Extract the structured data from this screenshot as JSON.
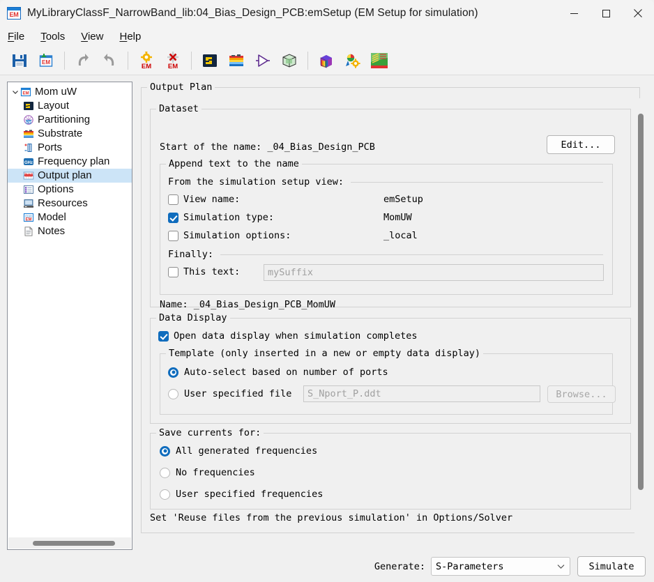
{
  "window": {
    "title": "MyLibraryClassF_NarrowBand_lib:04_Bias_Design_PCB:emSetup (EM Setup for simulation)",
    "app_icon": "em-window-icon",
    "app_icon_text": "EM",
    "minimize": "minimize-icon",
    "maximize": "maximize-icon",
    "close": "close-icon"
  },
  "menubar": {
    "items": [
      {
        "label": "File",
        "accel": "F"
      },
      {
        "label": "Tools",
        "accel": "T"
      },
      {
        "label": "View",
        "accel": "V"
      },
      {
        "label": "Help",
        "accel": "H"
      }
    ]
  },
  "toolbar": {
    "buttons": [
      {
        "name": "save-icon",
        "title": "Save"
      },
      {
        "name": "save-em-icon",
        "title": "Save EM setup"
      },
      {
        "name": "undo-icon",
        "title": "Undo"
      },
      {
        "name": "redo-icon",
        "title": "Redo"
      },
      {
        "name": "em-settings-icon",
        "title": "EM settings"
      },
      {
        "name": "em-delete-icon",
        "title": "Delete EM"
      },
      {
        "name": "layout-icon",
        "title": "Layout"
      },
      {
        "name": "substrate-icon",
        "title": "Substrate"
      },
      {
        "name": "simulate-icon",
        "title": "Simulate"
      },
      {
        "name": "3d-view-icon",
        "title": "3D view"
      },
      {
        "name": "3d-cube-icon",
        "title": "3D EM view"
      },
      {
        "name": "em-model-icon",
        "title": "EM model"
      },
      {
        "name": "em-mesh-icon",
        "title": "Mesh view"
      }
    ]
  },
  "sidebar": {
    "root": {
      "label": "Mom uW",
      "icon": "em-icon",
      "expanded": true,
      "twist": "chevron-down-icon"
    },
    "items": [
      {
        "label": "Layout",
        "icon": "layout-icon",
        "selected": false
      },
      {
        "label": "Partitioning",
        "icon": "partitioning-icon",
        "selected": false
      },
      {
        "label": "Substrate",
        "icon": "substrate-icon",
        "selected": false
      },
      {
        "label": "Ports",
        "icon": "ports-icon",
        "selected": false
      },
      {
        "label": "Frequency plan",
        "icon": "ghz-icon",
        "selected": false
      },
      {
        "label": "Output plan",
        "icon": "output-plan-icon",
        "selected": true
      },
      {
        "label": "Options",
        "icon": "options-icon",
        "selected": false
      },
      {
        "label": "Resources",
        "icon": "resources-icon",
        "selected": false
      },
      {
        "label": "Model",
        "icon": "model-icon",
        "selected": false
      },
      {
        "label": "Notes",
        "icon": "notes-icon",
        "selected": false
      }
    ]
  },
  "main": {
    "group_title": "Output Plan",
    "dataset": {
      "legend": "Dataset",
      "start_of_name_label": "Start of the name: _04_Bias_Design_PCB",
      "edit_button": "Edit...",
      "append": {
        "legend": "Append text to the name",
        "from_view_label": "From the simulation setup view:",
        "rows": [
          {
            "label": "View name:",
            "value": "emSetup",
            "checked": false
          },
          {
            "label": "Simulation type:",
            "value": "MomUW",
            "checked": true
          },
          {
            "label": "Simulation options:",
            "value": "_local",
            "checked": false
          }
        ],
        "finally_label": "Finally:",
        "this_text_label": "This text:",
        "this_text_checked": false,
        "this_text_placeholder": "mySuffix",
        "this_text_value": ""
      },
      "name_label": "Name: _04_Bias_Design_PCB_MomUW"
    },
    "data_display": {
      "legend": "Data Display",
      "open_label": "Open data display when simulation completes",
      "open_checked": true,
      "template": {
        "legend": "Template (only inserted in a new or empty data display)",
        "options": [
          {
            "label": "Auto-select based on number of ports",
            "selected": true
          },
          {
            "label": "User specified file",
            "selected": false
          }
        ],
        "file_value": "S_Nport_P.ddt",
        "browse_button": "Browse..."
      }
    },
    "save_currents": {
      "legend": "Save currents for:",
      "options": [
        {
          "label": "All generated frequencies",
          "selected": true
        },
        {
          "label": "No frequencies",
          "selected": false
        },
        {
          "label": "User specified frequencies",
          "selected": false
        }
      ]
    },
    "hint": "Set 'Reuse files from the previous simulation' in Options/Solver"
  },
  "bottom": {
    "generate_label": "Generate:",
    "generate_value": "S-Parameters",
    "generate_caret": "chevron-down-icon",
    "simulate_button": "Simulate"
  },
  "colors": {
    "accent": "#0f6cbd",
    "selection": "#cce4f7",
    "window_bg": "#f0f0f0",
    "panel_bg": "#ffffff",
    "close_hover": "#e81123"
  }
}
